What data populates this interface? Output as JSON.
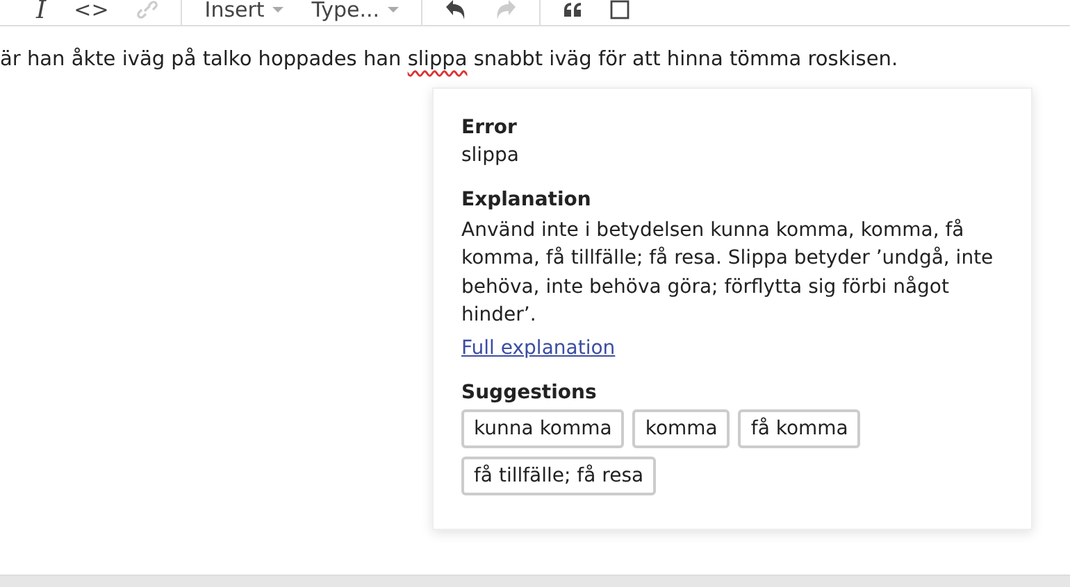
{
  "toolbar": {
    "items": [
      {
        "kind": "text",
        "label": "I",
        "disabled": false,
        "italic": true
      },
      {
        "kind": "text",
        "label": "<>",
        "disabled": false,
        "italic": false
      },
      {
        "kind": "link",
        "disabled": true
      },
      {
        "kind": "separator"
      },
      {
        "kind": "dropdown",
        "label": "Insert",
        "disabled": false
      },
      {
        "kind": "dropdown",
        "label": "Type...",
        "disabled": false
      },
      {
        "kind": "separator"
      },
      {
        "kind": "undo",
        "disabled": false
      },
      {
        "kind": "redo",
        "disabled": true
      },
      {
        "kind": "separator"
      },
      {
        "kind": "quote",
        "disabled": false
      },
      {
        "kind": "square",
        "disabled": false
      }
    ]
  },
  "editor": {
    "text_before": "är han åkte iväg på talko hoppades han ",
    "error_word": "slippa",
    "text_after": " snabbt iväg för att hinna tömma roskisen."
  },
  "popup": {
    "error_heading": "Error",
    "error_text": "slippa",
    "explanation_heading": "Explanation",
    "explanation_text": "Använd inte i betydelsen kunna komma, komma, få komma, få tillfälle; få resa. Slippa betyder ’undgå, inte behöva, inte behöva göra; förflytta sig förbi något hinder’.",
    "link": "Full explanation",
    "suggestions_heading": "Suggestions",
    "suggestions": [
      "kunna komma",
      "komma",
      "få komma",
      "få tillfälle; få resa"
    ]
  }
}
